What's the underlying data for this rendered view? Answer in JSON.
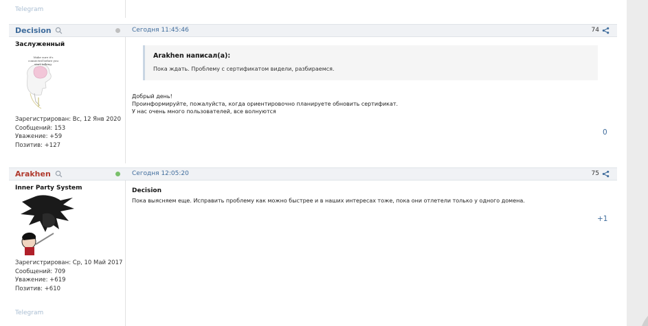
{
  "top_signature": "Telegram",
  "bottom_signature": "Telegram",
  "posts": [
    {
      "author": "Decision",
      "author_color": "#3f6c9c",
      "status_color": "#bfbfbf",
      "date": "Сегодня 11:45:46",
      "number": "74",
      "rank": "Заслуженный",
      "avatar_caption": "Make sure it's connected before you start talking.",
      "stats": [
        "Зарегистрирован: Вс, 12 Янв 2020",
        "Сообщений: 153",
        "Уважение: +59",
        "Позитив: +127"
      ],
      "quote": {
        "author": "Arakhen написал(а):",
        "text": "Пока ждать. Проблему с сертификатом видели, разбираемся."
      },
      "message_lines": [
        "Добрый день!",
        "Проинформируйте, пожалуйста, когда ориентировочно планируете обновить сертификат.",
        "У нас очень много пользователей, все волнуются"
      ],
      "reputation": "0"
    },
    {
      "author": "Arakhen",
      "author_color": "#b03a2e",
      "status_color": "#7ac06b",
      "date": "Сегодня 12:05:20",
      "number": "75",
      "rank": "Inner Party System",
      "stats": [
        "Зарегистрирован: Ср, 10 Май 2017",
        "Сообщений: 709",
        "Уважение: +619",
        "Позитив: +610"
      ],
      "reply_to": "Decision",
      "message_lines": [
        "Пока выясняем еще. Исправить проблему как можно быстрее и в наших интересах тоже, пока они отлетели только у одного домена."
      ],
      "reputation": "+1"
    }
  ]
}
